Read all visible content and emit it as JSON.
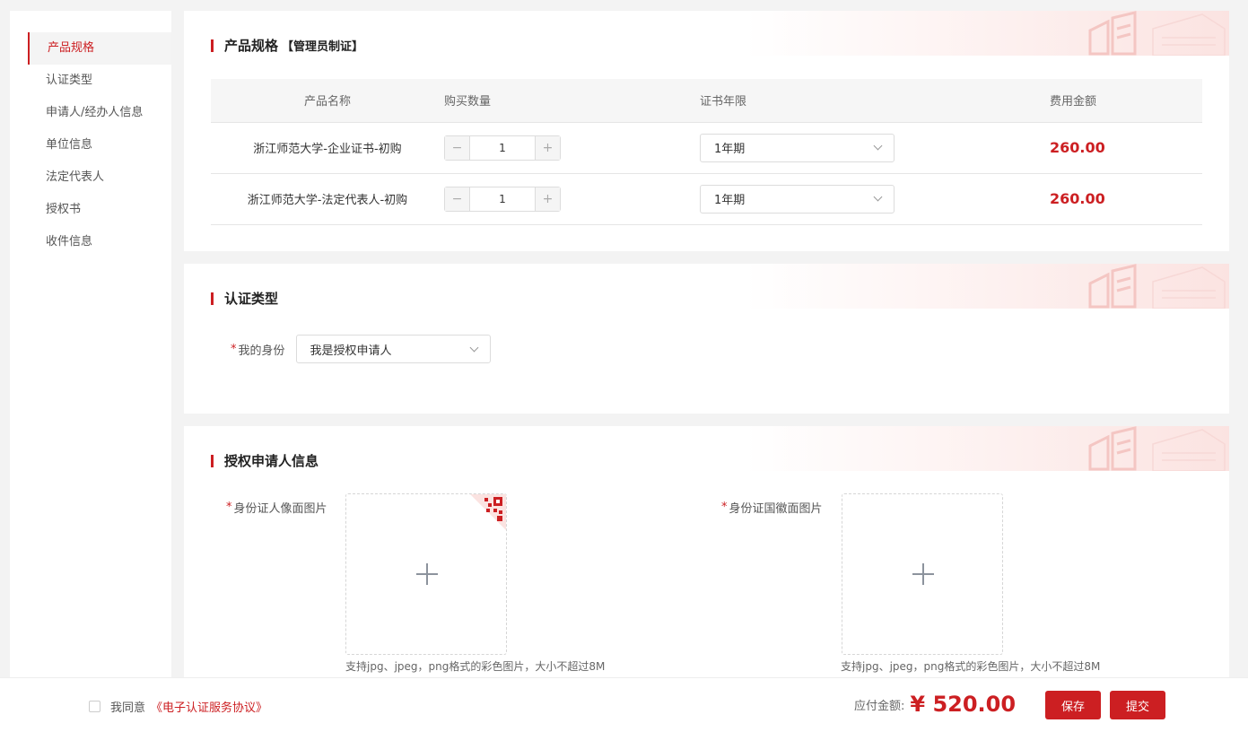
{
  "sidebar": {
    "items": [
      {
        "label": "产品规格",
        "active": true
      },
      {
        "label": "认证类型"
      },
      {
        "label": "申请人/经办人信息"
      },
      {
        "label": "单位信息"
      },
      {
        "label": "法定代表人"
      },
      {
        "label": "授权书"
      },
      {
        "label": "收件信息"
      }
    ]
  },
  "product_section": {
    "title": "产品规格",
    "subtitle": "【管理员制证】",
    "columns": [
      "产品名称",
      "购买数量",
      "证书年限",
      "费用金额"
    ],
    "rows": [
      {
        "name": "浙江师范大学-企业证书-初购",
        "qty_minus": "−",
        "qty": "1",
        "qty_plus": "+",
        "years": "1年期",
        "fee": "260.00"
      },
      {
        "name": "浙江师范大学-法定代表人-初购",
        "qty_minus": "−",
        "qty": "1",
        "qty_plus": "+",
        "years": "1年期",
        "fee": "260.00"
      }
    ]
  },
  "cert_type_section": {
    "title": "认证类型",
    "required_mark": "*",
    "identity_label": "我的身份",
    "identity_value": "我是授权申请人"
  },
  "applicant_section": {
    "title": "授权申请人信息",
    "uploads": [
      {
        "required_mark": "*",
        "label": "身份证人像面图片",
        "hint": "支持jpg、jpeg，png格式的彩色图片，大小不超过8M",
        "icon": "plus-icon"
      },
      {
        "required_mark": "*",
        "label": "身份证国徽面图片",
        "hint": "支持jpg、jpeg，png格式的彩色图片，大小不超过8M",
        "icon": "plus-icon"
      }
    ]
  },
  "footer": {
    "agree_text": "我同意",
    "agreement_link": "《电子认证服务协议》",
    "payable_label": "应付金额:",
    "payable_amount": "¥ 520.00",
    "save_label": "保存",
    "submit_label": "提交"
  },
  "colors": {
    "accent": "#cc1f22",
    "background": "#f3f3f3"
  }
}
